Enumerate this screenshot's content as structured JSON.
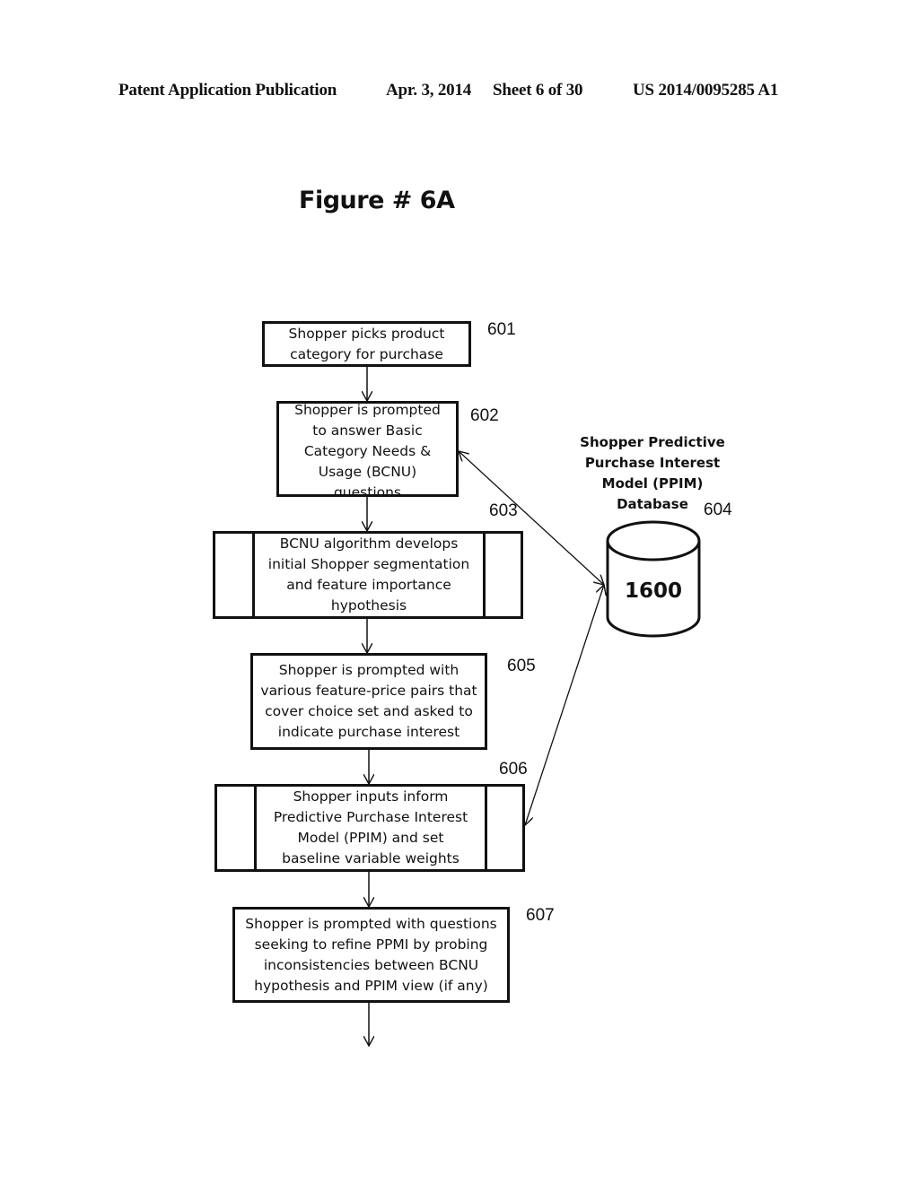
{
  "header": {
    "publication_type": "Patent Application Publication",
    "date": "Apr. 3, 2014",
    "sheet": "Sheet 6 of 30",
    "pub_number": "US 2014/0095285 A1"
  },
  "figure": {
    "title": "Figure # 6A"
  },
  "steps": [
    {
      "ref": "601",
      "text": "Shopper picks product\ncategory for purchase",
      "shape": "process"
    },
    {
      "ref": "602",
      "text": "Shopper is prompted\nto answer Basic\nCategory Needs &\nUsage (BCNU)\nquestions",
      "shape": "process"
    },
    {
      "ref": "603",
      "text": "BCNU algorithm develops\ninitial Shopper segmentation\nand feature importance\nhypothesis",
      "shape": "predefined-process"
    },
    {
      "ref": "605",
      "text": "Shopper is prompted with\nvarious feature-price pairs that\ncover choice set and asked to\nindicate purchase interest",
      "shape": "process"
    },
    {
      "ref": "606",
      "text": "Shopper inputs inform\nPredictive Purchase Interest\nModel (PPIM) and set\nbaseline variable weights",
      "shape": "predefined-process"
    },
    {
      "ref": "607",
      "text": "Shopper is prompted with questions\nseeking to refine PPMI by probing\ninconsistencies between BCNU\nhypothesis and PPIM view (if any)",
      "shape": "process"
    }
  ],
  "database": {
    "ref": "604",
    "label": "Shopper Predictive\nPurchase Interest\nModel (PPIM)\nDatabase",
    "value": "1600"
  },
  "connections": [
    {
      "from": "601",
      "to": "602",
      "type": "arrow"
    },
    {
      "from": "602",
      "to": "603",
      "type": "arrow"
    },
    {
      "from": "603",
      "to": "605",
      "type": "arrow"
    },
    {
      "from": "605",
      "to": "606",
      "type": "arrow"
    },
    {
      "from": "606",
      "to": "607",
      "type": "arrow"
    },
    {
      "from": "607",
      "to": "continues",
      "type": "arrow"
    },
    {
      "from": "602",
      "to": "604",
      "type": "bidirectional"
    },
    {
      "from": "606",
      "to": "604",
      "type": "bidirectional"
    }
  ]
}
